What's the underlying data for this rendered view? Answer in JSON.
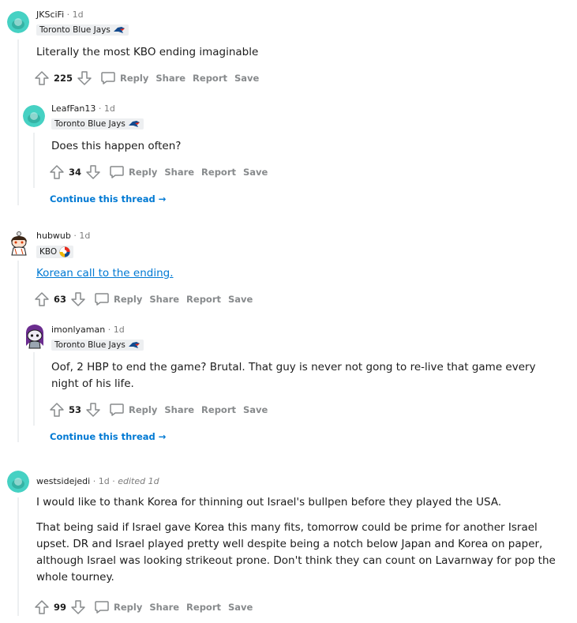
{
  "colors": {
    "link": "#0079d3",
    "muted": "#878a8c",
    "flair_bg": "#edeff1",
    "avatar_teal": "#46d1c3"
  },
  "action_labels": {
    "reply": "Reply",
    "share": "Share",
    "report": "Report",
    "save": "Save"
  },
  "continue_label": "Continue this thread",
  "comments": [
    {
      "user": "JKSciFi",
      "time": "1d",
      "flair": "Toronto Blue Jays",
      "flair_icon": "blue-jays-logo-icon",
      "body": "Literally the most KBO ending imaginable",
      "votes": "225"
    },
    {
      "user": "LeafFan13",
      "time": "1d",
      "flair": "Toronto Blue Jays",
      "flair_icon": "blue-jays-logo-icon",
      "body": "Does this happen often?",
      "votes": "34"
    },
    {
      "user": "hubwub",
      "time": "1d",
      "flair": "KBO",
      "flair_icon": "kbo-logo-icon",
      "body": "Korean call to the ending.",
      "votes": "63"
    },
    {
      "user": "imonlyaman",
      "time": "1d",
      "flair": "Toronto Blue Jays",
      "flair_icon": "blue-jays-logo-icon",
      "body": "Oof, 2 HBP to end the game? Brutal. That guy is never not gong to re-live that game every night of his life.",
      "votes": "53"
    },
    {
      "user": "westsidejedi",
      "time": "1d",
      "edited": "edited 1d",
      "body_p1": "I would like to thank Korea for thinning out Israel's bullpen before they played the USA.",
      "body_p2": "That being said if Israel gave Korea this many fits, tomorrow could be prime for another Israel upset. DR and Israel played pretty well despite being a notch below Japan and Korea on paper, although Israel was looking strikeout prone. Don't think they can count on Lavarnway for pop the whole tourney.",
      "votes": "99"
    }
  ]
}
